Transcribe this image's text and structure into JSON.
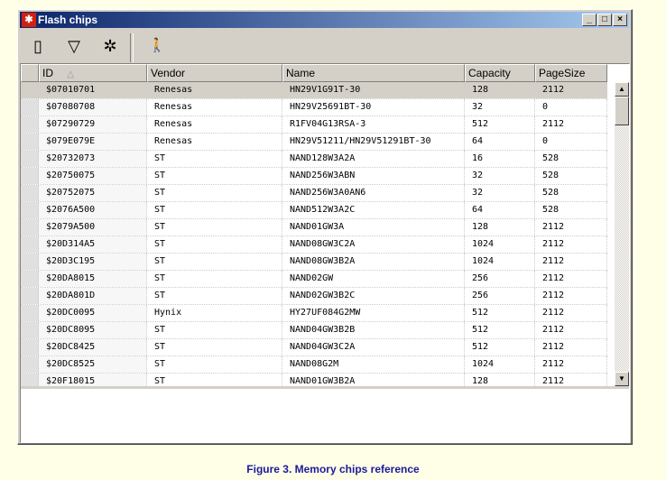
{
  "window": {
    "title": "Flash chips",
    "minimize": "_",
    "maximize": "□",
    "close": "×"
  },
  "toolbar": {
    "buttons": [
      {
        "icon": "new-document-icon",
        "glyph": "▯"
      },
      {
        "icon": "filter-document-icon",
        "glyph": "▽"
      },
      {
        "icon": "delete-document-icon",
        "glyph": "✲"
      },
      {
        "icon": "exit-icon",
        "glyph": "🚶"
      }
    ]
  },
  "table": {
    "columns": [
      "ID",
      "Vendor",
      "Name",
      "Capacity",
      "PageSize"
    ],
    "sort_indicator": "△",
    "rows": [
      [
        "$07010701",
        "Renesas",
        "HN29V1G91T-30",
        "128",
        "2112"
      ],
      [
        "$07080708",
        "Renesas",
        "HN29V25691BT-30",
        "32",
        "0"
      ],
      [
        "$07290729",
        "Renesas",
        "R1FV04G13RSA-3",
        "512",
        "2112"
      ],
      [
        "$079E079E",
        "Renesas",
        "HN29V51211/HN29V51291BT-30",
        "64",
        "0"
      ],
      [
        "$20732073",
        "ST",
        "NAND128W3A2A",
        "16",
        "528"
      ],
      [
        "$20750075",
        "ST",
        "NAND256W3ABN",
        "32",
        "528"
      ],
      [
        "$20752075",
        "ST",
        "NAND256W3A0AN6",
        "32",
        "528"
      ],
      [
        "$2076A500",
        "ST",
        "NAND512W3A2C",
        "64",
        "528"
      ],
      [
        "$2079A500",
        "ST",
        "NAND01GW3A",
        "128",
        "2112"
      ],
      [
        "$20D314A5",
        "ST",
        "NAND08GW3C2A",
        "1024",
        "2112"
      ],
      [
        "$20D3C195",
        "ST",
        "NAND08GW3B2A",
        "1024",
        "2112"
      ],
      [
        "$20DA8015",
        "ST",
        "NAND02GW",
        "256",
        "2112"
      ],
      [
        "$20DA801D",
        "ST",
        "NAND02GW3B2C",
        "256",
        "2112"
      ],
      [
        "$20DC0095",
        "Hynix",
        "HY27UF084G2MW",
        "512",
        "2112"
      ],
      [
        "$20DC8095",
        "ST",
        "NAND04GW3B2B",
        "512",
        "2112"
      ],
      [
        "$20DC8425",
        "ST",
        "NAND04GW3C2A",
        "512",
        "2112"
      ],
      [
        "$20DC8525",
        "ST",
        "NAND08G2M",
        "1024",
        "2112"
      ],
      [
        "$20F18015",
        "ST",
        "NAND01GW3B2A",
        "128",
        "2112"
      ]
    ],
    "selected_row": 0
  },
  "scrollbar": {
    "up": "▲",
    "down": "▼"
  },
  "caption": "Figure 3. Memory chips reference"
}
